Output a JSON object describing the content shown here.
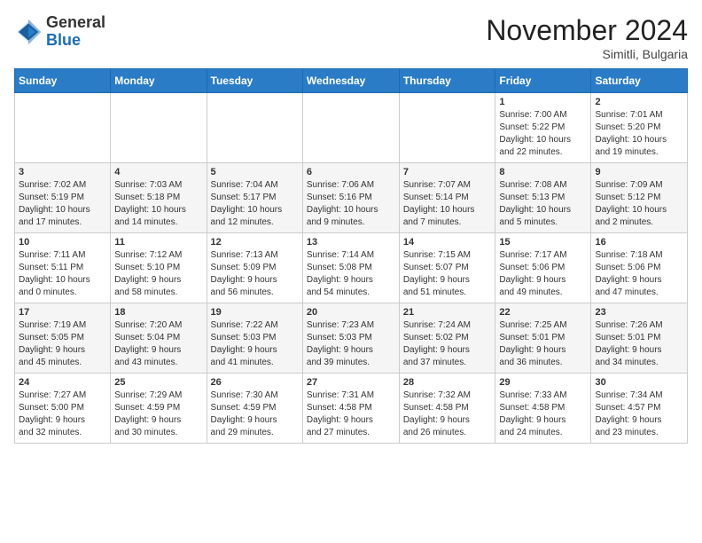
{
  "header": {
    "logo_general": "General",
    "logo_blue": "Blue",
    "month_title": "November 2024",
    "location": "Simitli, Bulgaria"
  },
  "weekdays": [
    "Sunday",
    "Monday",
    "Tuesday",
    "Wednesday",
    "Thursday",
    "Friday",
    "Saturday"
  ],
  "weeks": [
    [
      {
        "day": "",
        "info": ""
      },
      {
        "day": "",
        "info": ""
      },
      {
        "day": "",
        "info": ""
      },
      {
        "day": "",
        "info": ""
      },
      {
        "day": "",
        "info": ""
      },
      {
        "day": "1",
        "info": "Sunrise: 7:00 AM\nSunset: 5:22 PM\nDaylight: 10 hours\nand 22 minutes."
      },
      {
        "day": "2",
        "info": "Sunrise: 7:01 AM\nSunset: 5:20 PM\nDaylight: 10 hours\nand 19 minutes."
      }
    ],
    [
      {
        "day": "3",
        "info": "Sunrise: 7:02 AM\nSunset: 5:19 PM\nDaylight: 10 hours\nand 17 minutes."
      },
      {
        "day": "4",
        "info": "Sunrise: 7:03 AM\nSunset: 5:18 PM\nDaylight: 10 hours\nand 14 minutes."
      },
      {
        "day": "5",
        "info": "Sunrise: 7:04 AM\nSunset: 5:17 PM\nDaylight: 10 hours\nand 12 minutes."
      },
      {
        "day": "6",
        "info": "Sunrise: 7:06 AM\nSunset: 5:16 PM\nDaylight: 10 hours\nand 9 minutes."
      },
      {
        "day": "7",
        "info": "Sunrise: 7:07 AM\nSunset: 5:14 PM\nDaylight: 10 hours\nand 7 minutes."
      },
      {
        "day": "8",
        "info": "Sunrise: 7:08 AM\nSunset: 5:13 PM\nDaylight: 10 hours\nand 5 minutes."
      },
      {
        "day": "9",
        "info": "Sunrise: 7:09 AM\nSunset: 5:12 PM\nDaylight: 10 hours\nand 2 minutes."
      }
    ],
    [
      {
        "day": "10",
        "info": "Sunrise: 7:11 AM\nSunset: 5:11 PM\nDaylight: 10 hours\nand 0 minutes."
      },
      {
        "day": "11",
        "info": "Sunrise: 7:12 AM\nSunset: 5:10 PM\nDaylight: 9 hours\nand 58 minutes."
      },
      {
        "day": "12",
        "info": "Sunrise: 7:13 AM\nSunset: 5:09 PM\nDaylight: 9 hours\nand 56 minutes."
      },
      {
        "day": "13",
        "info": "Sunrise: 7:14 AM\nSunset: 5:08 PM\nDaylight: 9 hours\nand 54 minutes."
      },
      {
        "day": "14",
        "info": "Sunrise: 7:15 AM\nSunset: 5:07 PM\nDaylight: 9 hours\nand 51 minutes."
      },
      {
        "day": "15",
        "info": "Sunrise: 7:17 AM\nSunset: 5:06 PM\nDaylight: 9 hours\nand 49 minutes."
      },
      {
        "day": "16",
        "info": "Sunrise: 7:18 AM\nSunset: 5:06 PM\nDaylight: 9 hours\nand 47 minutes."
      }
    ],
    [
      {
        "day": "17",
        "info": "Sunrise: 7:19 AM\nSunset: 5:05 PM\nDaylight: 9 hours\nand 45 minutes."
      },
      {
        "day": "18",
        "info": "Sunrise: 7:20 AM\nSunset: 5:04 PM\nDaylight: 9 hours\nand 43 minutes."
      },
      {
        "day": "19",
        "info": "Sunrise: 7:22 AM\nSunset: 5:03 PM\nDaylight: 9 hours\nand 41 minutes."
      },
      {
        "day": "20",
        "info": "Sunrise: 7:23 AM\nSunset: 5:03 PM\nDaylight: 9 hours\nand 39 minutes."
      },
      {
        "day": "21",
        "info": "Sunrise: 7:24 AM\nSunset: 5:02 PM\nDaylight: 9 hours\nand 37 minutes."
      },
      {
        "day": "22",
        "info": "Sunrise: 7:25 AM\nSunset: 5:01 PM\nDaylight: 9 hours\nand 36 minutes."
      },
      {
        "day": "23",
        "info": "Sunrise: 7:26 AM\nSunset: 5:01 PM\nDaylight: 9 hours\nand 34 minutes."
      }
    ],
    [
      {
        "day": "24",
        "info": "Sunrise: 7:27 AM\nSunset: 5:00 PM\nDaylight: 9 hours\nand 32 minutes."
      },
      {
        "day": "25",
        "info": "Sunrise: 7:29 AM\nSunset: 4:59 PM\nDaylight: 9 hours\nand 30 minutes."
      },
      {
        "day": "26",
        "info": "Sunrise: 7:30 AM\nSunset: 4:59 PM\nDaylight: 9 hours\nand 29 minutes."
      },
      {
        "day": "27",
        "info": "Sunrise: 7:31 AM\nSunset: 4:58 PM\nDaylight: 9 hours\nand 27 minutes."
      },
      {
        "day": "28",
        "info": "Sunrise: 7:32 AM\nSunset: 4:58 PM\nDaylight: 9 hours\nand 26 minutes."
      },
      {
        "day": "29",
        "info": "Sunrise: 7:33 AM\nSunset: 4:58 PM\nDaylight: 9 hours\nand 24 minutes."
      },
      {
        "day": "30",
        "info": "Sunrise: 7:34 AM\nSunset: 4:57 PM\nDaylight: 9 hours\nand 23 minutes."
      }
    ]
  ]
}
